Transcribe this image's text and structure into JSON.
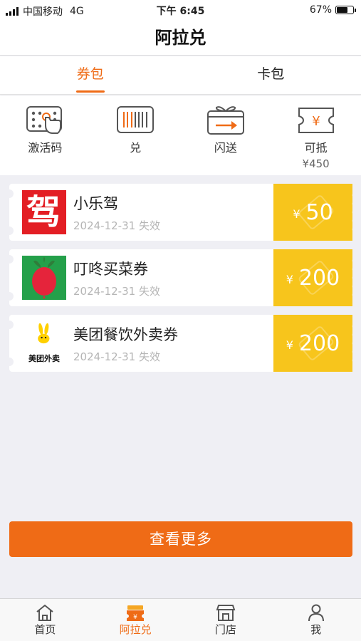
{
  "status_bar": {
    "carrier": "中国移动",
    "network": "4G",
    "time": "下午 6:45",
    "battery": "67%",
    "battery_level": 0.67
  },
  "nav": {
    "title": "阿拉兑"
  },
  "tabs": [
    {
      "label": "券包",
      "active": true
    },
    {
      "label": "卡包",
      "active": false
    }
  ],
  "actions": [
    {
      "label": "激活码",
      "icon": "activation-code-icon"
    },
    {
      "label": "兑",
      "icon": "barcode-icon"
    },
    {
      "label": "闪送",
      "icon": "gift-send-icon"
    },
    {
      "label": "可抵",
      "icon": "yen-ticket-icon",
      "sub": "¥450"
    }
  ],
  "coupons": [
    {
      "name": "小乐驾",
      "date": "2024-12-31 失效",
      "currency": "¥",
      "amount": "50",
      "logo_text": "驾"
    },
    {
      "name": "叮咚买菜券",
      "date": "2024-12-31 失效",
      "currency": "¥",
      "amount": "200",
      "logo_text": ""
    },
    {
      "name": "美团餐饮外卖券",
      "date": "2024-12-31 失效",
      "currency": "¥",
      "amount": "200",
      "logo_text": "美团外卖"
    }
  ],
  "more_button": "查看更多",
  "tabbar": [
    {
      "label": "首页",
      "icon": "home-icon",
      "active": false
    },
    {
      "label": "阿拉兑",
      "icon": "ticket-icon",
      "active": true
    },
    {
      "label": "门店",
      "icon": "store-icon",
      "active": false
    },
    {
      "label": "我",
      "icon": "person-icon",
      "active": false
    }
  ],
  "colors": {
    "accent": "#ef6b16",
    "coupon_value_bg": "#f7c51c"
  }
}
